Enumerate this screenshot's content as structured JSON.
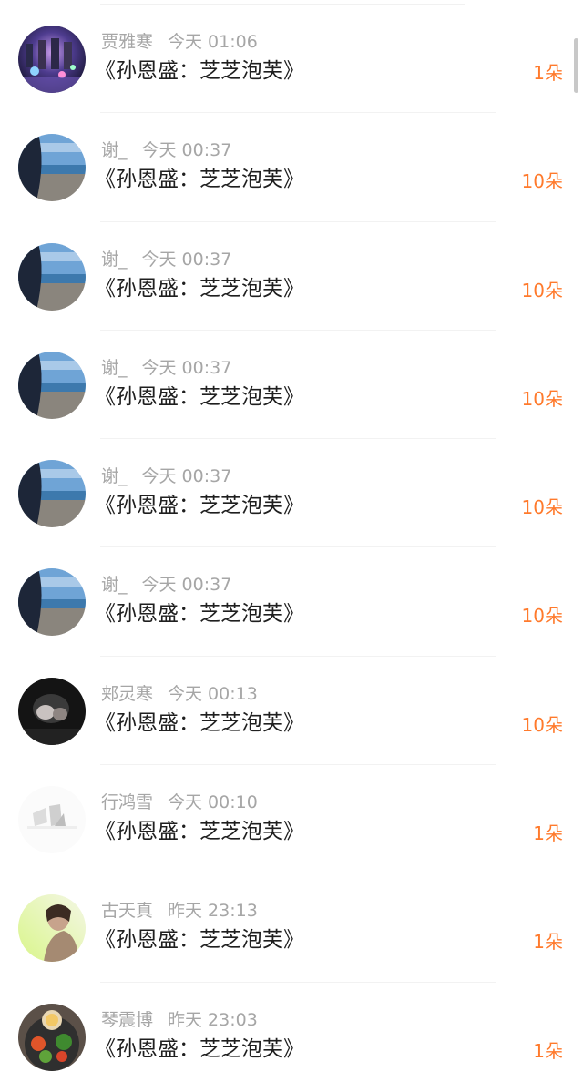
{
  "rows": [
    {
      "name": "贾雅寒",
      "time": "今天 01:06",
      "title": "《孙恩盛：芝芝泡芙》",
      "amount": "1朵",
      "avatar": "avatar-stage"
    },
    {
      "name": "谢_",
      "time": "今天 00:37",
      "title": "《孙恩盛：芝芝泡芙》",
      "amount": "10朵",
      "avatar": "avatar-beach"
    },
    {
      "name": "谢_",
      "time": "今天 00:37",
      "title": "《孙恩盛：芝芝泡芙》",
      "amount": "10朵",
      "avatar": "avatar-beach"
    },
    {
      "name": "谢_",
      "time": "今天 00:37",
      "title": "《孙恩盛：芝芝泡芙》",
      "amount": "10朵",
      "avatar": "avatar-beach"
    },
    {
      "name": "谢_",
      "time": "今天 00:37",
      "title": "《孙恩盛：芝芝泡芙》",
      "amount": "10朵",
      "avatar": "avatar-beach"
    },
    {
      "name": "谢_",
      "time": "今天 00:37",
      "title": "《孙恩盛：芝芝泡芙》",
      "amount": "10朵",
      "avatar": "avatar-beach"
    },
    {
      "name": "郏灵寒",
      "time": "今天 00:13",
      "title": "《孙恩盛：芝芝泡芙》",
      "amount": "10朵",
      "avatar": "avatar-dark"
    },
    {
      "name": "行鸿雪",
      "time": "今天 00:10",
      "title": "《孙恩盛：芝芝泡芙》",
      "amount": "1朵",
      "avatar": "avatar-white"
    },
    {
      "name": "古天真",
      "time": "昨天 23:13",
      "title": "《孙恩盛：芝芝泡芙》",
      "amount": "1朵",
      "avatar": "avatar-green"
    },
    {
      "name": "琴震博",
      "time": "昨天 23:03",
      "title": "《孙恩盛：芝芝泡芙》",
      "amount": "1朵",
      "avatar": "avatar-food"
    }
  ],
  "colors": {
    "amount": "#ff7a2c",
    "meta": "#a6a6a6",
    "title": "#1f1f1f"
  }
}
